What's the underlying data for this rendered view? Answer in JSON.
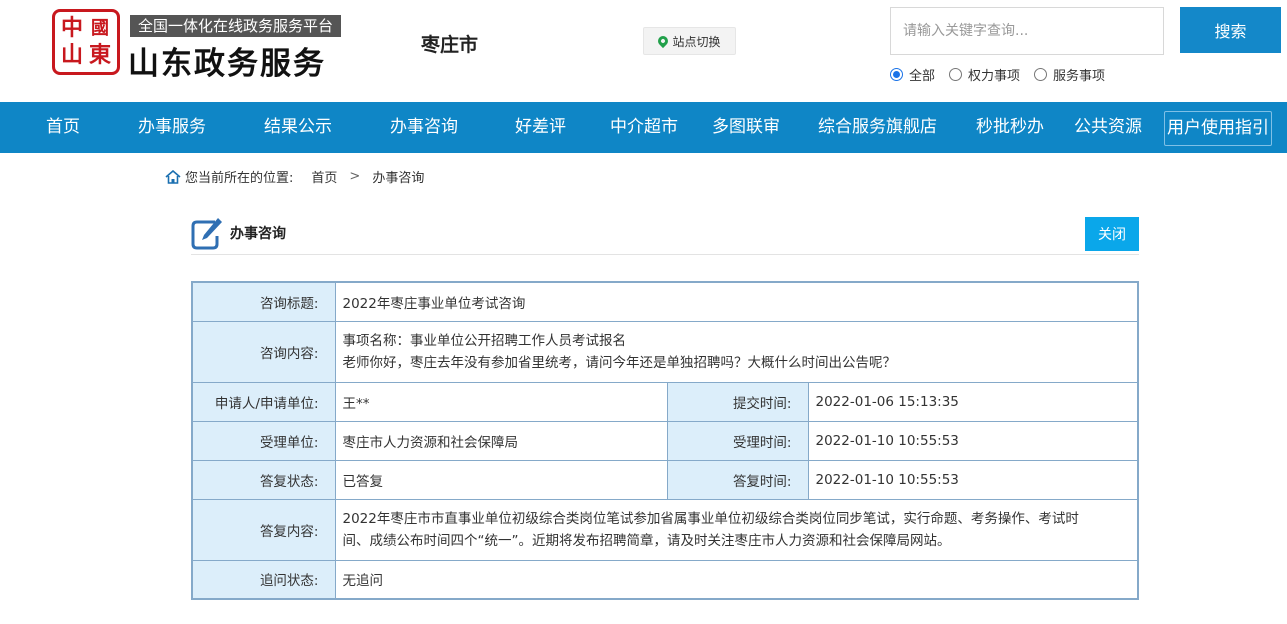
{
  "header": {
    "logo_seal_chars": [
      "中",
      "國",
      "山",
      "東"
    ],
    "platform_tagline": "全国一体化在线政务服务平台",
    "brand_title": "山东政务服务",
    "city": "枣庄市",
    "site_switch_label": "站点切换",
    "search": {
      "placeholder": "请输入关键字查询...",
      "button_label": "搜索"
    },
    "search_scope": [
      {
        "label": "全部",
        "selected": true
      },
      {
        "label": "权力事项",
        "selected": false
      },
      {
        "label": "服务事项",
        "selected": false
      }
    ]
  },
  "nav": {
    "items": [
      "首页",
      "办事服务",
      "结果公示",
      "办事咨询",
      "好差评",
      "中介超市",
      "多图联审",
      "综合服务旗舰店",
      "秒批秒办",
      "公共资源",
      "用户使用指引"
    ]
  },
  "breadcrumb": {
    "prefix": "您当前所在的位置:",
    "items": [
      "首页",
      "办事咨询"
    ],
    "separator": ">"
  },
  "panel": {
    "title": "办事咨询",
    "close_label": "关闭"
  },
  "consultation": {
    "subject_label": "咨询标题:",
    "subject": "2022年枣庄事业单位考试咨询",
    "content_label": "咨询内容:",
    "content_item": "事项名称：事业单位公开招聘工作人员考试报名",
    "content_text": "老师你好，枣庄去年没有参加省里统考，请问今年还是单独招聘吗？大概什么时间出公告呢？",
    "applicant_label": "申请人/申请单位:",
    "applicant": "王**",
    "submit_time_label": "提交时间:",
    "submit_time": "2022-01-06 15:13:35",
    "handler_label": "受理单位:",
    "handler": "枣庄市人力资源和社会保障局",
    "accept_time_label": "受理时间:",
    "accept_time": "2022-01-10 10:55:53",
    "reply_status_label": "答复状态:",
    "reply_status": "已答复",
    "reply_time_label": "答复时间:",
    "reply_time": "2022-01-10 10:55:53",
    "reply_content_label": "答复内容:",
    "reply_content_line1": "2022年枣庄市市直事业单位初级综合类岗位笔试参加省属事业单位初级综合类岗位同步笔试，实行命题、考务操作、考试时",
    "reply_content_line2": "间、成绩公布时间四个“统一”。近期将发布招聘简章，请及时关注枣庄市人力资源和社会保障局网站。",
    "followup_label": "追问状态:",
    "followup": "无追问"
  },
  "colors": {
    "nav_bg": "#0f86c6",
    "search_button": "#1488c9",
    "close_button": "#0aa7ea",
    "label_cell_bg": "#dceefa",
    "table_border": "#85a9c9",
    "seal_red": "#c8181e"
  }
}
